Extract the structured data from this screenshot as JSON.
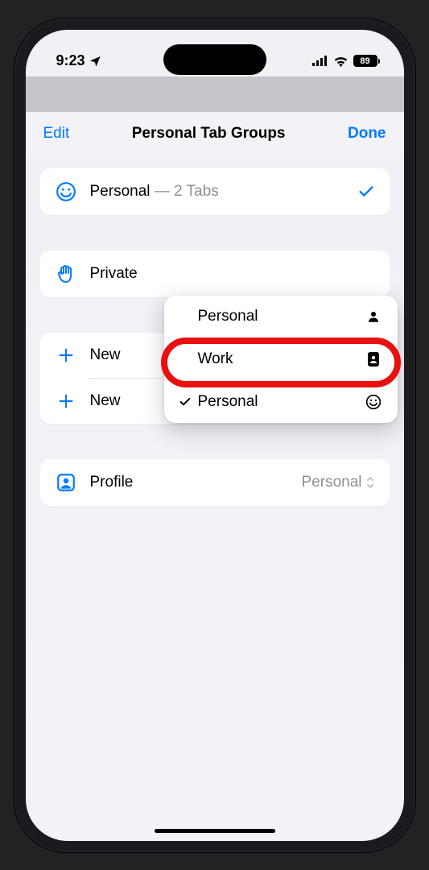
{
  "status_bar": {
    "time": "9:23",
    "battery": "89"
  },
  "header": {
    "edit_label": "Edit",
    "title": "Personal Tab Groups",
    "done_label": "Done"
  },
  "groups": {
    "personal": {
      "label": "Personal",
      "suffix": " — 2 Tabs"
    },
    "private": {
      "label": "Private"
    }
  },
  "actions": {
    "new1": "New",
    "new2": "New"
  },
  "profile": {
    "label": "Profile",
    "value": "Personal"
  },
  "popup": {
    "items": [
      {
        "label": "Personal",
        "checked": false
      },
      {
        "label": "Work",
        "checked": false
      },
      {
        "label": "Personal",
        "checked": true
      }
    ]
  }
}
